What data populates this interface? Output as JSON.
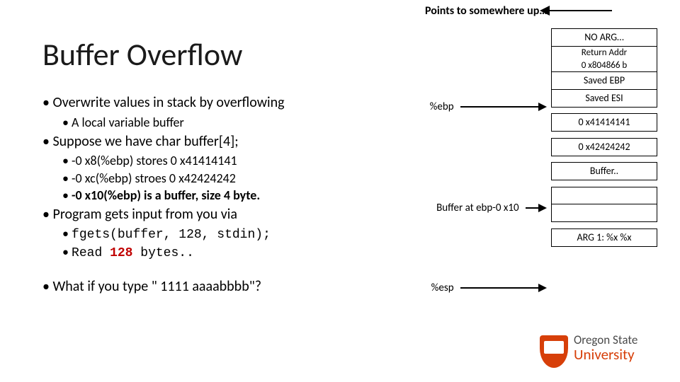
{
  "top_note": "Points to somewhere up…",
  "title": "Buffer Overflow",
  "bullets": {
    "b1": "Overwrite values in stack by overflowing",
    "b1a": "A local variable buffer",
    "b2": "Suppose we have char buffer[4];",
    "b2a": "-0 x8(%ebp) stores 0 x41414141",
    "b2b": "-0 xc(%ebp) stroes 0 x42424242",
    "b2c_pre": "-0 x10(%ebp) is a buffer, size 4 byte.",
    "b3": "Program gets input from you via",
    "b3a": "fgets(buffer, 128, stdin);",
    "b3b_pre": "Read ",
    "b3b_num": "128",
    "b3b_post": " bytes..",
    "b4": "What if you type \" 1111 aaaabbbb\"?"
  },
  "stack": {
    "cells": {
      "noarg": "NO ARG…",
      "ret_l1": "Return Addr",
      "ret_l2": "0 x804866 b",
      "savedebp": "Saved EBP",
      "savedesi": "Saved ESI",
      "v41": "0 x41414141",
      "v42": "0 x42424242",
      "buf": "Buffer..",
      "arg1": "ARG 1: %x %x"
    },
    "labels": {
      "ebp": "%ebp",
      "bufat": "Buffer at ebp-0 x10",
      "esp": "%esp"
    }
  },
  "logo": {
    "l1": "Oregon State",
    "l2": "University"
  }
}
